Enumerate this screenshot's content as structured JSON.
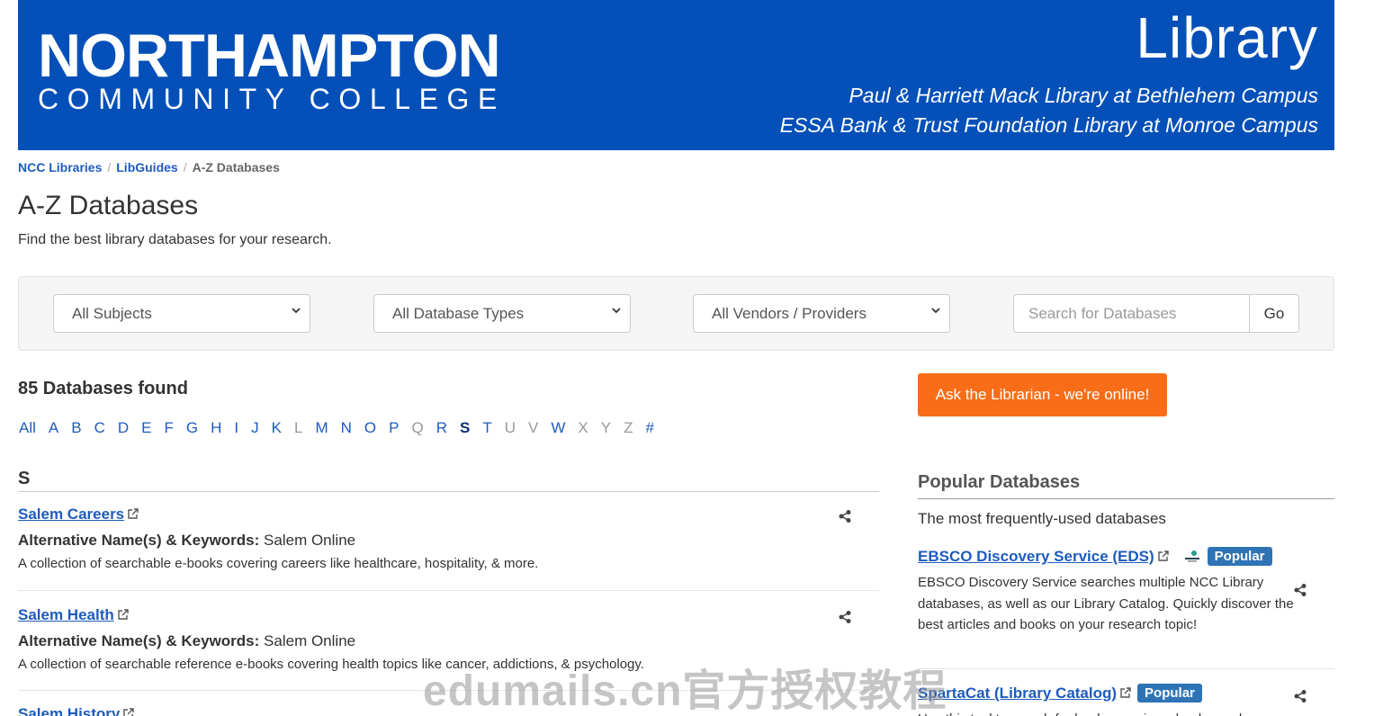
{
  "banner": {
    "college_line1": "NORTHAMPTON",
    "college_line2": "COMMUNITY COLLEGE",
    "library": "Library",
    "campus1": "Paul & Harriett Mack Library at Bethlehem Campus",
    "campus2": "ESSA Bank & Trust Foundation Library at Monroe Campus",
    "bg_color": "#0450b8"
  },
  "breadcrumb": {
    "items": [
      "NCC Libraries",
      "LibGuides"
    ],
    "current": "A-Z Databases",
    "separator": "/"
  },
  "page": {
    "title": "A-Z Databases",
    "intro": "Find the best library databases for your research."
  },
  "filters": {
    "subjects": "All Subjects",
    "types": "All Database Types",
    "vendors": "All Vendors / Providers",
    "search_placeholder": "Search for Databases",
    "go_label": "Go"
  },
  "results": {
    "count_label": "85 Databases found",
    "letters": [
      "All",
      "A",
      "B",
      "C",
      "D",
      "E",
      "F",
      "G",
      "H",
      "I",
      "J",
      "K",
      "L",
      "M",
      "N",
      "O",
      "P",
      "Q",
      "R",
      "S",
      "T",
      "U",
      "V",
      "W",
      "X",
      "Y",
      "Z",
      "#"
    ],
    "active_letter": "S",
    "disabled_letters": [
      "L",
      "Q",
      "U",
      "V",
      "X",
      "Y",
      "Z"
    ],
    "section_letter": "S",
    "entries": [
      {
        "name": "Salem Careers",
        "alt_label": "Alternative Name(s) & Keywords:",
        "alt_value": "Salem Online",
        "description": "A collection of searchable e-books covering careers like healthcare, hospitality, & more."
      },
      {
        "name": "Salem Health",
        "alt_label": "Alternative Name(s) & Keywords:",
        "alt_value": "Salem Online",
        "description": "A collection of searchable reference e-books covering health topics like cancer, addictions, & psychology."
      },
      {
        "name": "Salem History",
        "alt_label": "",
        "alt_value": "",
        "description": ""
      }
    ]
  },
  "sidebar": {
    "ask_label": "Ask the Librarian - we're online!",
    "ask_color": "#f96d18",
    "popular_heading": "Popular Databases",
    "popular_subtitle": "The most frequently-used databases",
    "popular": [
      {
        "name": "EBSCO Discovery Service (EDS)",
        "badge": "Popular",
        "description": "EBSCO Discovery Service searches multiple NCC Library databases, as well as our Library Catalog. Quickly discover the best articles and books on your research topic!"
      },
      {
        "name": "SpartaCat (Library Catalog)",
        "badge": "Popular",
        "description": "Use this tool to search for books, movies, ebooks, and"
      }
    ]
  },
  "watermark": "edumails.cn官方授权教程",
  "colors": {
    "link": "#1e5bbd",
    "badge": "#2e74b5"
  }
}
